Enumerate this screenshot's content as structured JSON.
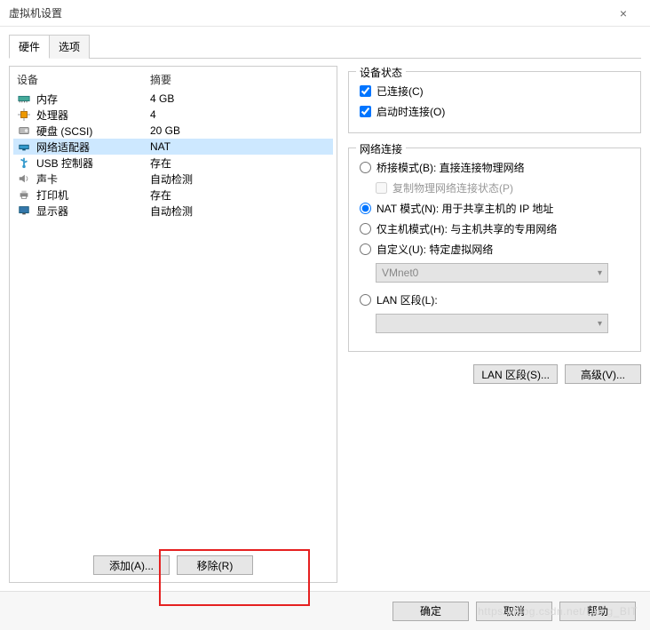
{
  "title": "虚拟机设置",
  "tabs": {
    "hardware": "硬件",
    "options": "选项"
  },
  "columns": {
    "device": "设备",
    "summary": "摘要"
  },
  "hardware": [
    {
      "icon": "memory-icon",
      "label": "内存",
      "summary": "4 GB"
    },
    {
      "icon": "cpu-icon",
      "label": "处理器",
      "summary": "4"
    },
    {
      "icon": "disk-icon",
      "label": "硬盘 (SCSI)",
      "summary": "20 GB"
    },
    {
      "icon": "network-icon",
      "label": "网络适配器",
      "summary": "NAT"
    },
    {
      "icon": "usb-icon",
      "label": "USB 控制器",
      "summary": "存在"
    },
    {
      "icon": "sound-icon",
      "label": "声卡",
      "summary": "自动检测"
    },
    {
      "icon": "printer-icon",
      "label": "打印机",
      "summary": "存在"
    },
    {
      "icon": "display-icon",
      "label": "显示器",
      "summary": "自动检测"
    }
  ],
  "selected_index": 3,
  "buttons": {
    "add": "添加(A)...",
    "remove": "移除(R)"
  },
  "device_status": {
    "legend": "设备状态",
    "connected": "已连接(C)",
    "connect_at_power_on": "启动时连接(O)"
  },
  "net_conn": {
    "legend": "网络连接",
    "bridged": "桥接模式(B): 直接连接物理网络",
    "replicate": "复制物理网络连接状态(P)",
    "nat": "NAT 模式(N): 用于共享主机的 IP 地址",
    "hostonly": "仅主机模式(H): 与主机共享的专用网络",
    "custom": "自定义(U): 特定虚拟网络",
    "custom_value": "VMnet0",
    "lan_segment": "LAN 区段(L):",
    "lan_value": ""
  },
  "right_buttons": {
    "lan_segments": "LAN 区段(S)...",
    "advanced": "高级(V)..."
  },
  "footer": {
    "ok": "确定",
    "cancel": "取消",
    "help": "帮助"
  },
  "watermark": "https://blog.csdn.net/Dong_BIT"
}
